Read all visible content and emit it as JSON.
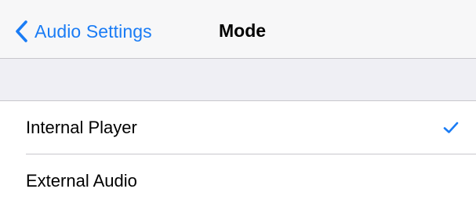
{
  "navbar": {
    "back_label": "Audio Settings",
    "back_icon": "chevron-left-icon",
    "title": "Mode"
  },
  "options": [
    {
      "label": "Internal Player",
      "selected": true
    },
    {
      "label": "External Audio",
      "selected": false
    }
  ],
  "colors": {
    "accent": "#1a7cf5",
    "navbar_bg": "#f7f7f8",
    "group_bg": "#efeff4",
    "separator": "#c8c7cc"
  },
  "icons": {
    "selected": "checkmark-icon"
  }
}
